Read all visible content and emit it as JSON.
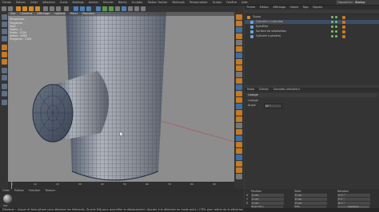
{
  "menu": [
    "Fichier",
    "Édition",
    "Créer",
    "Sélection",
    "Outils",
    "Maillage",
    "Animer",
    "Simuler",
    "Rendu",
    "Sculpter",
    "Motion Tracker",
    "MoGraph",
    "Personnaliser",
    "Scripts",
    "Fenêtre",
    "Aide"
  ],
  "layout": {
    "label": "Disposition:",
    "value": "Startup (Utilisateur)"
  },
  "viewport": {
    "menu": [
      "Vue",
      "Caméras",
      "Affichage",
      "Options",
      "Filtrer",
      "Panneau"
    ],
    "title": "Perspective",
    "overlay_lines": [
      "Polygones",
      "Total",
      "Objets : 1",
      "Points : 2184",
      "Arêtes : 4368",
      "Polygones : 2184"
    ],
    "grid_label": "Espacement de la grille : 100 cm"
  },
  "object_manager": {
    "tabs": [
      "Fichier",
      "Édition",
      "Affichage",
      "Objets",
      "Tags",
      "Signets"
    ],
    "objects": [
      {
        "name": "Tuyau",
        "selected": false
      },
      {
        "name": "Cylindre.1 (cylindre)",
        "selected": true
      },
      {
        "name": "Symétrie",
        "selected": false
      },
      {
        "name": "Surface de subdivision",
        "selected": false
      },
      {
        "name": "Cylindre (cylindre)",
        "selected": false
      }
    ]
  },
  "attributes": {
    "tabs": [
      "Mode",
      "Édition",
      "Données utilisateur"
    ],
    "section": "Lissage",
    "label_row1": "Lissage",
    "label_row2": "Angle",
    "angle_value": "80 °"
  },
  "timeline": {
    "frames": [
      "0",
      "10",
      "20",
      "30",
      "40",
      "50",
      "60",
      "70",
      "80",
      "90"
    ]
  },
  "materials": {
    "menu": [
      "Créer",
      "Édition",
      "Fonction",
      "Texture"
    ],
    "material_name": "Mat"
  },
  "coordinates": {
    "headers": [
      "Position",
      "Taille",
      "Rotation"
    ],
    "rows": [
      {
        "axis": "X",
        "pos": "0 cm",
        "size": "0 cm",
        "rot": "H 0 °"
      },
      {
        "axis": "Y",
        "pos": "0 cm",
        "size": "0 cm",
        "rot": "P 0 °"
      },
      {
        "axis": "Z",
        "pos": "0 cm",
        "size": "0 cm",
        "rot": "B 0 °"
      }
    ],
    "mode": "Objet (Rel.)",
    "size_mode": "Taille",
    "apply": "Appliquer"
  },
  "status": "Déplacer : cliquer et faire glisser pour déplacer les éléments. Touche MAJ pour quantifier le déplacement / Ajouter à la sélection en mode point / CTRL pour retirer de la sélection."
}
